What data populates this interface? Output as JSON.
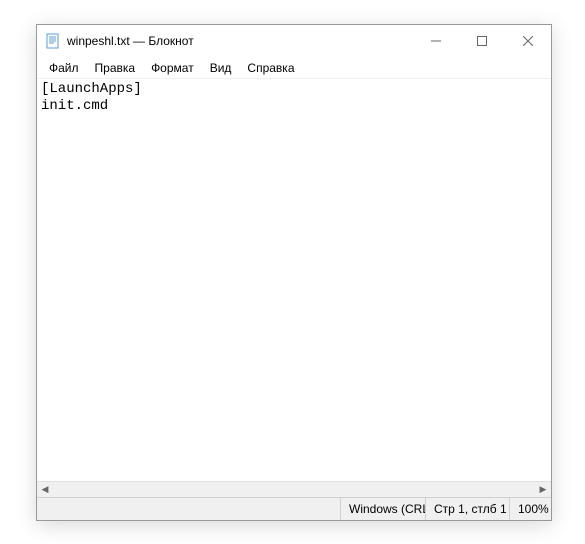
{
  "titlebar": {
    "title": "winpeshl.txt — Блокнот"
  },
  "menu": {
    "file": "Файл",
    "edit": "Правка",
    "format": "Формат",
    "view": "Вид",
    "help": "Справка"
  },
  "editor": {
    "content": "[LaunchApps]\ninit.cmd"
  },
  "statusbar": {
    "encoding": "Windows (CRL",
    "position": "Стр 1, стлб 1",
    "zoom": "100%"
  }
}
